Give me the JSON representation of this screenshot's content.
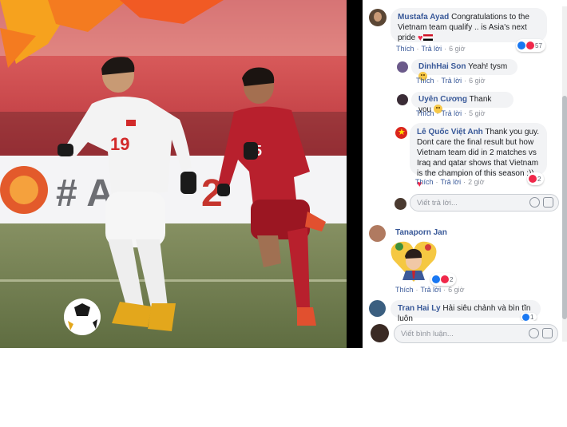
{
  "photo": {
    "banner_text": "# A",
    "banner_digit": "2",
    "banner_top_text": "",
    "player_left_number": "19",
    "player_right_number": "5"
  },
  "comments": [
    {
      "author": "Mustafa Ayad",
      "text": "Congratulations to the Vietnam team qualify .. is Asia's next pride",
      "like": "Thích",
      "reply": "Trả lời",
      "time": "6 giờ",
      "reaction_count": "57"
    },
    {
      "author": "DinhHai Son",
      "text": "Yeah! tysm",
      "like": "Thích",
      "reply": "Trả lời",
      "time": "6 giờ"
    },
    {
      "author": "Uyên Cương",
      "text": "Thank you",
      "like": "Thích",
      "reply": "Trả lời",
      "time": "5 giờ"
    },
    {
      "author": "Lê Quốc Việt Anh",
      "text": "Thank you guy. Dont care the final result but how Vietnam team did in 2 matches vs Iraq and qatar shows that Vietnam is the champion of this season :))",
      "like": "Thích",
      "reply": "Trả lời",
      "time": "2 giờ",
      "reaction_count": "2"
    },
    {
      "author": "Tanaporn Jan",
      "text": "",
      "like": "Thích",
      "reply": "Trả lời",
      "time": "6 giờ",
      "reaction_count": "2"
    },
    {
      "author": "Tran Hai Ly",
      "text": "Hải siêu chảnh và bìn tĩn luôn",
      "reaction_count": "1"
    }
  ],
  "reply_box": {
    "placeholder": "Viết trả lời..."
  },
  "comment_box": {
    "placeholder": "Viết bình luận..."
  },
  "colors": {
    "link": "#385898",
    "bubble": "#f2f3f5",
    "heart": "#f0284a",
    "like": "#1877f2"
  }
}
